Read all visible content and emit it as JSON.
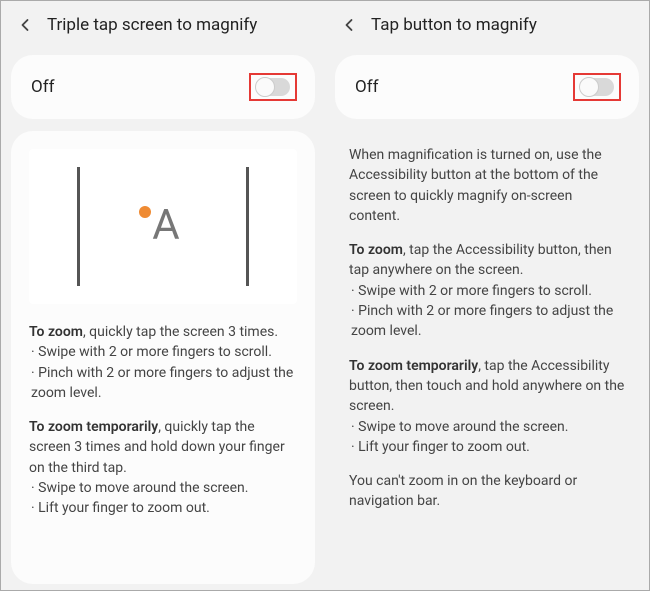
{
  "left": {
    "title": "Triple tap screen to magnify",
    "toggle_label": "Off",
    "p1_bold": "To zoom",
    "p1_rest": ", quickly tap the screen 3 times.",
    "p1_b1": "· Swipe with 2 or more fingers to scroll.",
    "p1_b2": "· Pinch with 2 or more fingers to adjust the",
    "p1_b2_cont": "  zoom level.",
    "p2_bold": "To zoom temporarily",
    "p2_rest": ", quickly tap the screen 3 times and hold down your finger on the third tap.",
    "p2_b1": "· Swipe to move around the screen.",
    "p2_b2": "· Lift your finger to zoom out."
  },
  "right": {
    "title": "Tap button to magnify",
    "toggle_label": "Off",
    "p0": "When magnification is turned on, use the Accessibility button at the bottom of the screen to quickly magnify on-screen content.",
    "p1_bold": "To zoom",
    "p1_rest": ", tap the Accessibility button, then tap anywhere on the screen.",
    "p1_b1": "· Swipe with 2 or more fingers to scroll.",
    "p1_b2": "· Pinch with 2 or more fingers to adjust the",
    "p1_b2_cont": "  zoom level.",
    "p2_bold": "To zoom temporarily",
    "p2_rest": ", tap the Accessibility button, then touch and hold anywhere on the screen.",
    "p2_b1": "· Swipe to move around the screen.",
    "p2_b2": "· Lift your finger to zoom out.",
    "p3": "You can't zoom in on the keyboard or navigation bar."
  }
}
